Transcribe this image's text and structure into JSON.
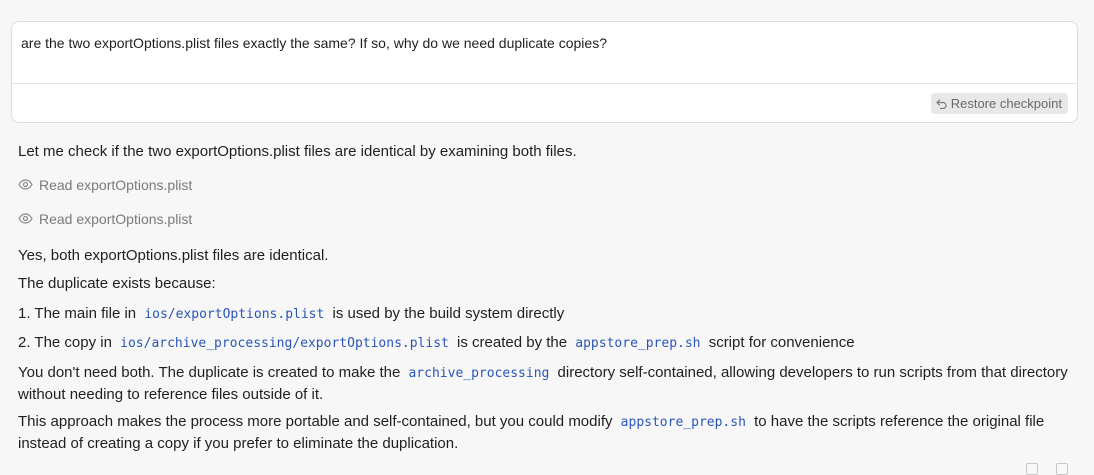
{
  "prompt": {
    "text": "are the two exportOptions.plist  files exactly the same? If so, why do we need duplicate copies?",
    "restore_label": "Restore checkpoint"
  },
  "response": {
    "intro": "Let me check if the two exportOptions.plist files are identical by examining both files.",
    "tool_calls": [
      {
        "icon": "eye-icon",
        "label": "Read exportOptions.plist"
      },
      {
        "icon": "eye-icon",
        "label": "Read exportOptions.plist"
      }
    ],
    "answer": "Yes, both exportOptions.plist files are identical.",
    "reason_intro": "The duplicate exists because:",
    "list": [
      {
        "num": "1.",
        "pre": "The main file in",
        "code": "ios/exportOptions.plist",
        "post": "is used by the build system directly",
        "code2": "",
        "post2": ""
      },
      {
        "num": "2.",
        "pre": "The copy in",
        "code": "ios/archive_processing/exportOptions.plist",
        "post": "is created by the",
        "code2": "appstore_prep.sh",
        "post2": "script for convenience"
      }
    ],
    "para1": {
      "pre": "You don't need both. The duplicate is created to make the",
      "code": "archive_processing",
      "post": "directory self-contained, allowing developers to run scripts from that directory without needing to reference files outside of it."
    },
    "para2": {
      "pre": "This approach makes the process more portable and self-contained, but you could modify",
      "code": "appstore_prep.sh",
      "post": "to have the scripts reference the original file instead of creating a copy if you prefer to eliminate the duplication."
    }
  },
  "colors": {
    "code_text": "#2a56b8",
    "muted_text": "#7a7a7a",
    "background": "#f7f7f7"
  }
}
